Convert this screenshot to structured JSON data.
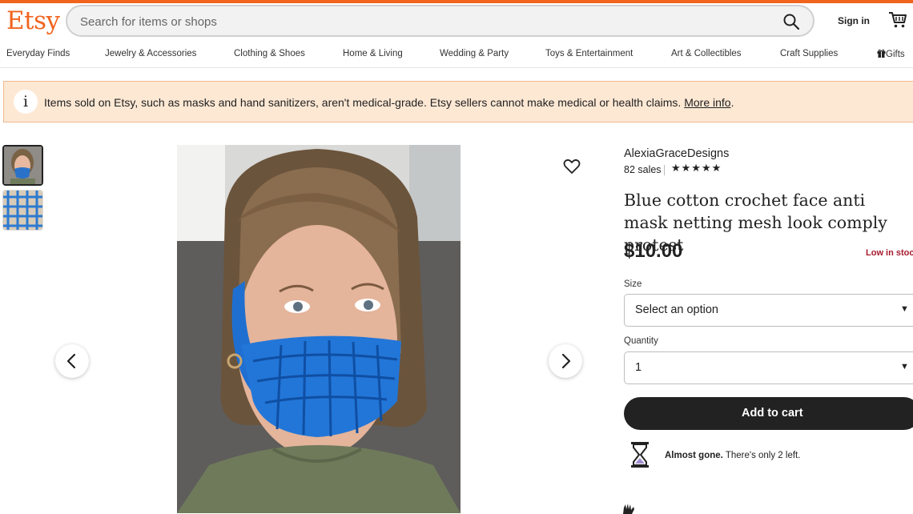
{
  "header": {
    "logo": "Etsy",
    "search_placeholder": "Search for items or shops",
    "sign_in": "Sign in"
  },
  "nav": {
    "items": [
      "Everyday Finds",
      "Jewelry & Accessories",
      "Clothing & Shoes",
      "Home & Living",
      "Wedding & Party",
      "Toys & Entertainment",
      "Art & Collectibles",
      "Craft Supplies",
      "Gifts"
    ]
  },
  "notice": {
    "text": "Items sold on Etsy, such as masks and hand sanitizers, aren't medical-grade. Etsy sellers cannot make medical or health claims.",
    "link": "More info",
    "period": "."
  },
  "listing": {
    "shop_name": "AlexiaGraceDesigns",
    "sales": "82 sales",
    "stars": "★★★★★",
    "rating": 5,
    "title": "Blue cotton crochet face anti mask netting mesh look comply protest",
    "price": "$10.00",
    "stock_status": "Low in stoc",
    "size_label": "Size",
    "size_value": "Select an option",
    "quantity_label": "Quantity",
    "quantity_value": "1",
    "add_to_cart": "Add to cart",
    "almost_gone": "Almost gone.",
    "almost_gone_detail": " There's only 2 left."
  },
  "colors": {
    "brand": "#f1641e",
    "notice_bg": "#fde8d4",
    "button": "#222222",
    "low_stock": "#a61a2e"
  }
}
